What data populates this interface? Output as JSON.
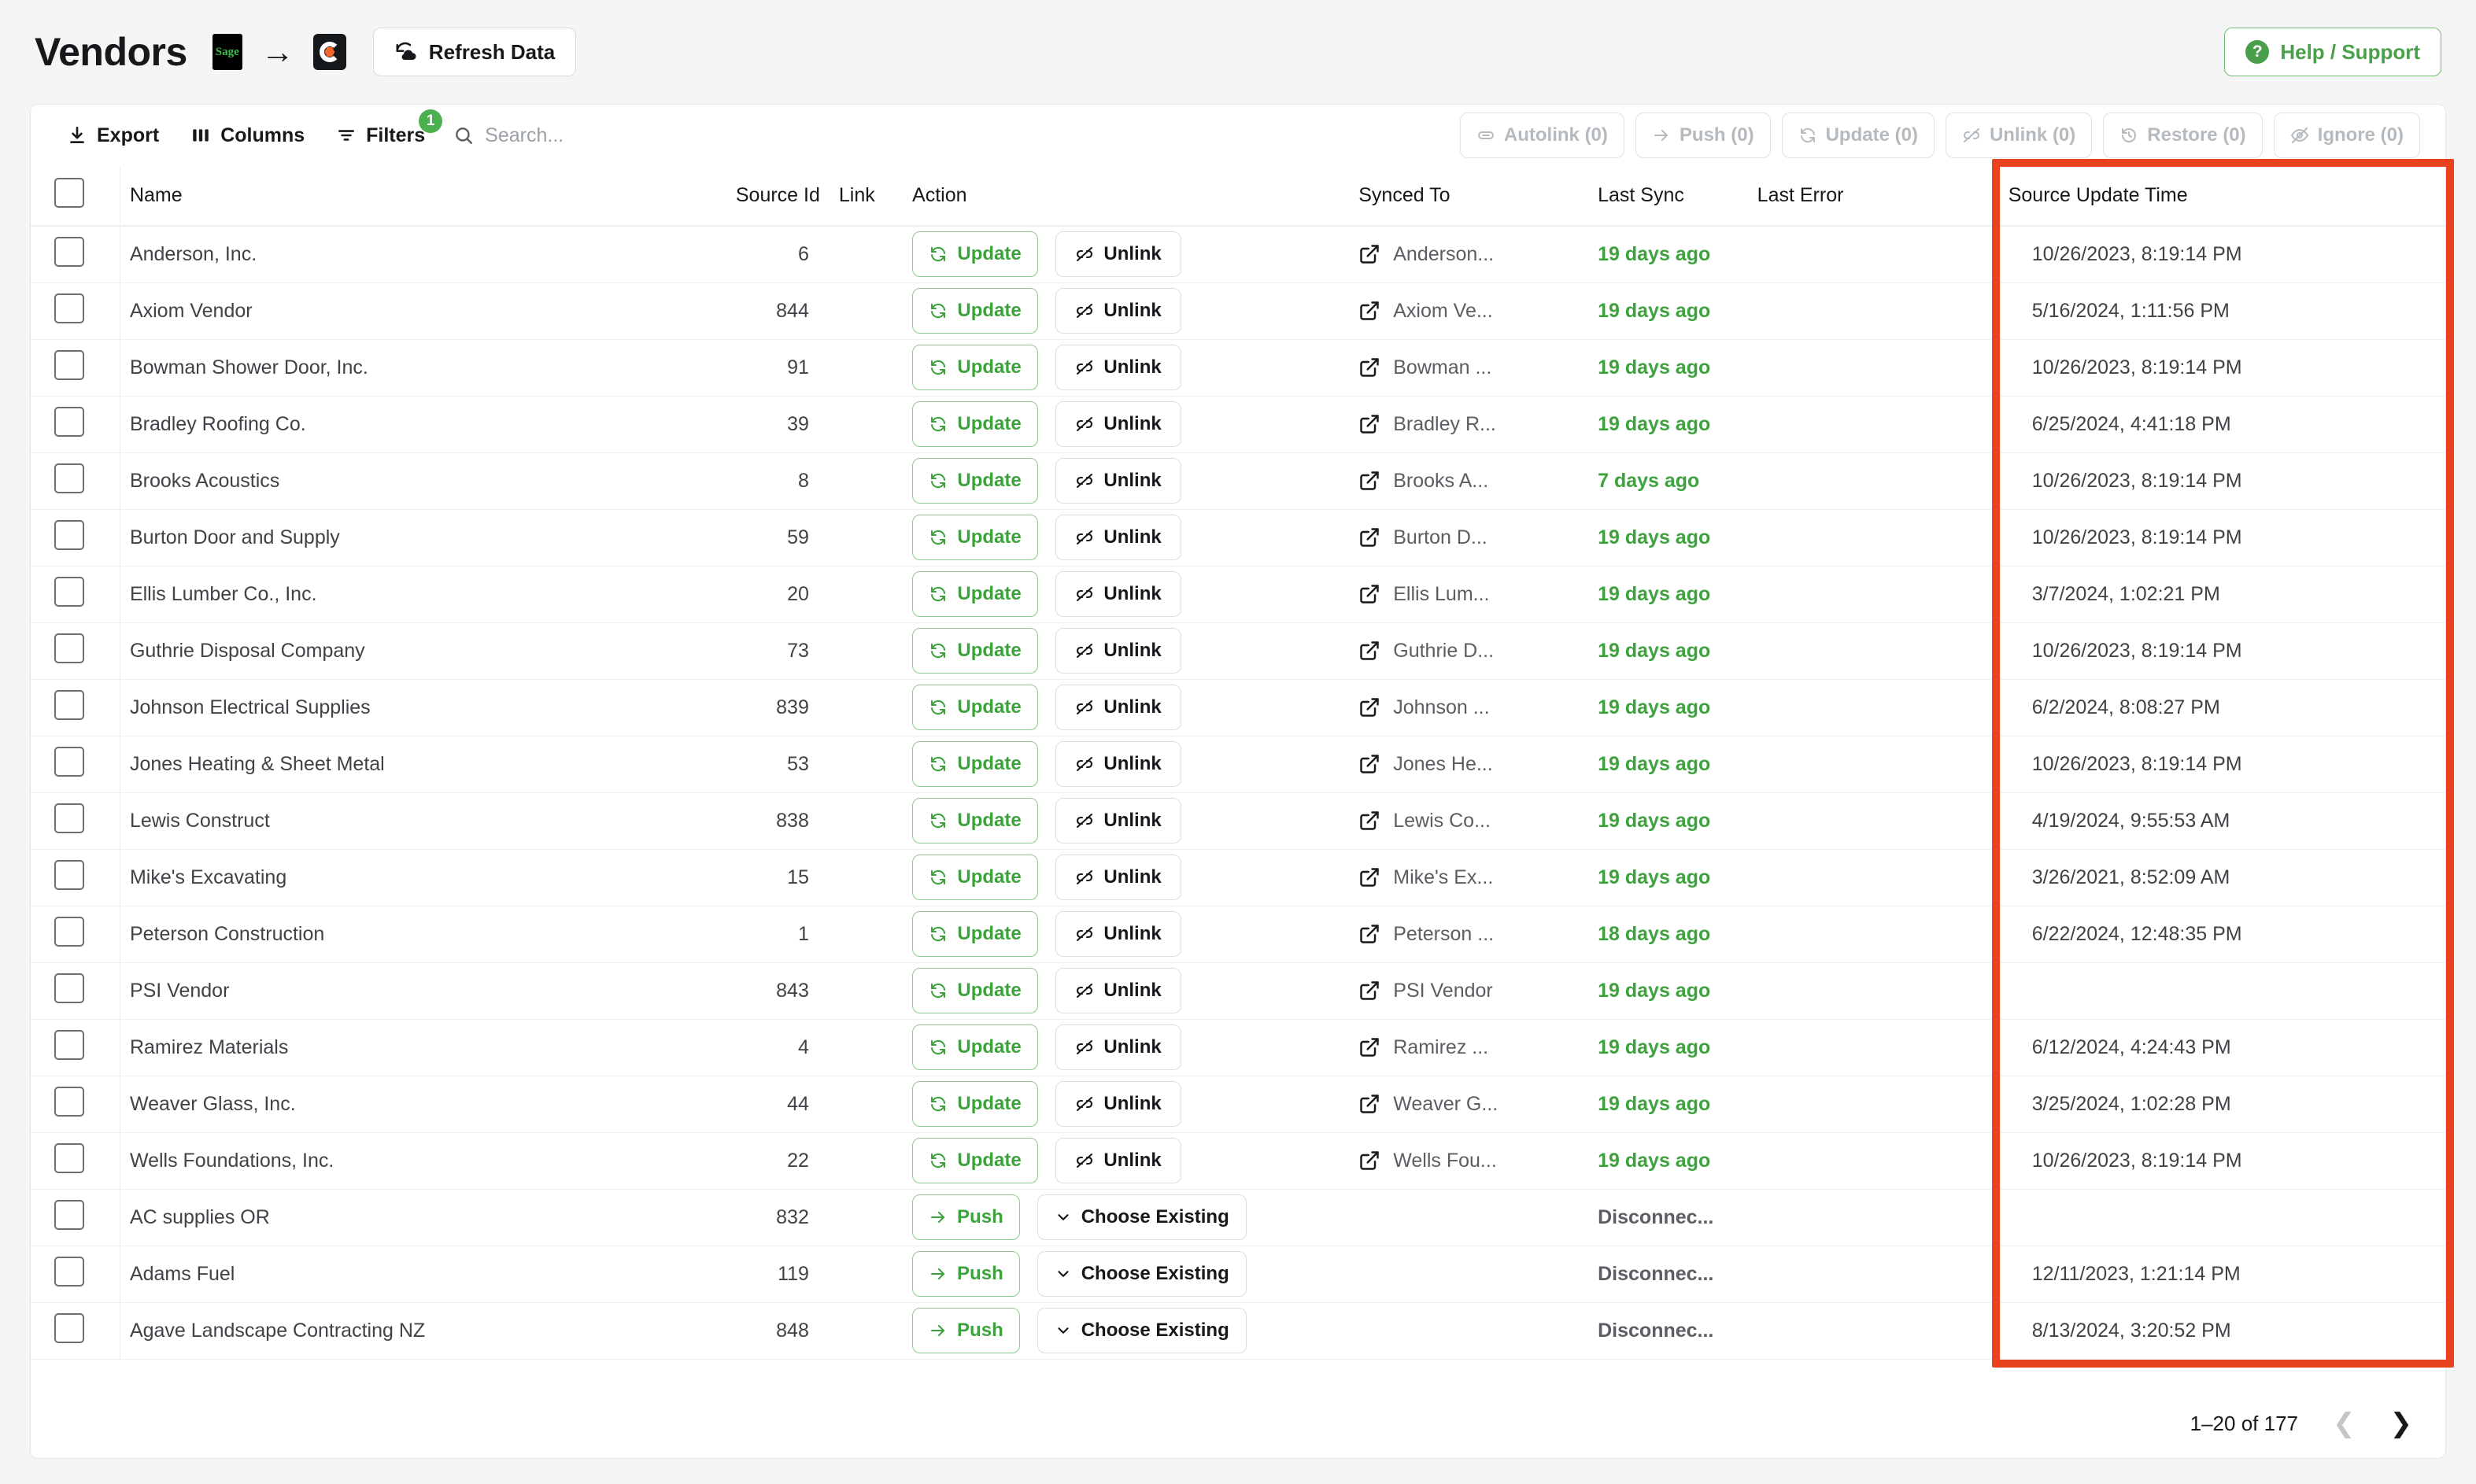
{
  "header": {
    "title": "Vendors",
    "source_logo_label": "Sage",
    "arrow": "→",
    "target_logo_label": "Procore",
    "refresh_label": "Refresh Data",
    "help_label": "Help / Support"
  },
  "toolbar": {
    "export_label": "Export",
    "columns_label": "Columns",
    "filters_label": "Filters",
    "filters_badge": "1",
    "search_placeholder": "Search...",
    "search_value": "",
    "bulk_actions": [
      {
        "label": "Autolink (0)",
        "icon": "link-icon",
        "disabled": true
      },
      {
        "label": "Push (0)",
        "icon": "arrow-right-icon",
        "disabled": true
      },
      {
        "label": "Update (0)",
        "icon": "refresh-icon",
        "disabled": true
      },
      {
        "label": "Unlink (0)",
        "icon": "unlink-icon",
        "disabled": true
      },
      {
        "label": "Restore (0)",
        "icon": "history-icon",
        "disabled": true
      },
      {
        "label": "Ignore (0)",
        "icon": "eye-off-icon",
        "disabled": true
      }
    ]
  },
  "table": {
    "columns": [
      "",
      "Name",
      "Source Id",
      "Link",
      "Action",
      "Synced To",
      "Last Sync",
      "Last Error",
      "Source Update Time"
    ],
    "rows": [
      {
        "name": "Anderson, Inc.",
        "source_id": "6",
        "action_primary": "Update",
        "action_secondary": "Unlink",
        "synced_to": "Anderson...",
        "last_sync": "19 days ago",
        "last_sync_state": "ok",
        "last_error": "",
        "source_update_time": "10/26/2023, 8:19:14 PM"
      },
      {
        "name": "Axiom Vendor",
        "source_id": "844",
        "action_primary": "Update",
        "action_secondary": "Unlink",
        "synced_to": "Axiom Ve...",
        "last_sync": "19 days ago",
        "last_sync_state": "ok",
        "last_error": "",
        "source_update_time": "5/16/2024, 1:11:56 PM"
      },
      {
        "name": "Bowman Shower Door, Inc.",
        "source_id": "91",
        "action_primary": "Update",
        "action_secondary": "Unlink",
        "synced_to": "Bowman ...",
        "last_sync": "19 days ago",
        "last_sync_state": "ok",
        "last_error": "",
        "source_update_time": "10/26/2023, 8:19:14 PM"
      },
      {
        "name": "Bradley Roofing Co.",
        "source_id": "39",
        "action_primary": "Update",
        "action_secondary": "Unlink",
        "synced_to": "Bradley R...",
        "last_sync": "19 days ago",
        "last_sync_state": "ok",
        "last_error": "",
        "source_update_time": "6/25/2024, 4:41:18 PM"
      },
      {
        "name": "Brooks Acoustics",
        "source_id": "8",
        "action_primary": "Update",
        "action_secondary": "Unlink",
        "synced_to": "Brooks A...",
        "last_sync": "7 days ago",
        "last_sync_state": "ok",
        "last_error": "",
        "source_update_time": "10/26/2023, 8:19:14 PM"
      },
      {
        "name": "Burton Door and Supply",
        "source_id": "59",
        "action_primary": "Update",
        "action_secondary": "Unlink",
        "synced_to": "Burton D...",
        "last_sync": "19 days ago",
        "last_sync_state": "ok",
        "last_error": "",
        "source_update_time": "10/26/2023, 8:19:14 PM"
      },
      {
        "name": "Ellis Lumber Co., Inc.",
        "source_id": "20",
        "action_primary": "Update",
        "action_secondary": "Unlink",
        "synced_to": "Ellis Lum...",
        "last_sync": "19 days ago",
        "last_sync_state": "ok",
        "last_error": "",
        "source_update_time": "3/7/2024, 1:02:21 PM"
      },
      {
        "name": "Guthrie Disposal Company",
        "source_id": "73",
        "action_primary": "Update",
        "action_secondary": "Unlink",
        "synced_to": "Guthrie D...",
        "last_sync": "19 days ago",
        "last_sync_state": "ok",
        "last_error": "",
        "source_update_time": "10/26/2023, 8:19:14 PM"
      },
      {
        "name": "Johnson Electrical Supplies",
        "source_id": "839",
        "action_primary": "Update",
        "action_secondary": "Unlink",
        "synced_to": "Johnson ...",
        "last_sync": "19 days ago",
        "last_sync_state": "ok",
        "last_error": "",
        "source_update_time": "6/2/2024, 8:08:27 PM"
      },
      {
        "name": "Jones Heating & Sheet Metal",
        "source_id": "53",
        "action_primary": "Update",
        "action_secondary": "Unlink",
        "synced_to": "Jones He...",
        "last_sync": "19 days ago",
        "last_sync_state": "ok",
        "last_error": "",
        "source_update_time": "10/26/2023, 8:19:14 PM"
      },
      {
        "name": "Lewis Construct",
        "source_id": "838",
        "action_primary": "Update",
        "action_secondary": "Unlink",
        "synced_to": "Lewis Co...",
        "last_sync": "19 days ago",
        "last_sync_state": "ok",
        "last_error": "",
        "source_update_time": "4/19/2024, 9:55:53 AM"
      },
      {
        "name": "Mike's Excavating",
        "source_id": "15",
        "action_primary": "Update",
        "action_secondary": "Unlink",
        "synced_to": "Mike's Ex...",
        "last_sync": "19 days ago",
        "last_sync_state": "ok",
        "last_error": "",
        "source_update_time": "3/26/2021, 8:52:09 AM"
      },
      {
        "name": "Peterson Construction",
        "source_id": "1",
        "action_primary": "Update",
        "action_secondary": "Unlink",
        "synced_to": "Peterson ...",
        "last_sync": "18 days ago",
        "last_sync_state": "ok",
        "last_error": "",
        "source_update_time": "6/22/2024, 12:48:35 PM"
      },
      {
        "name": "PSI Vendor",
        "source_id": "843",
        "action_primary": "Update",
        "action_secondary": "Unlink",
        "synced_to": "PSI Vendor",
        "last_sync": "19 days ago",
        "last_sync_state": "ok",
        "last_error": "",
        "source_update_time": ""
      },
      {
        "name": "Ramirez Materials",
        "source_id": "4",
        "action_primary": "Update",
        "action_secondary": "Unlink",
        "synced_to": "Ramirez ...",
        "last_sync": "19 days ago",
        "last_sync_state": "ok",
        "last_error": "",
        "source_update_time": "6/12/2024, 4:24:43 PM"
      },
      {
        "name": "Weaver Glass, Inc.",
        "source_id": "44",
        "action_primary": "Update",
        "action_secondary": "Unlink",
        "synced_to": "Weaver G...",
        "last_sync": "19 days ago",
        "last_sync_state": "ok",
        "last_error": "",
        "source_update_time": "3/25/2024, 1:02:28 PM"
      },
      {
        "name": "Wells Foundations, Inc.",
        "source_id": "22",
        "action_primary": "Update",
        "action_secondary": "Unlink",
        "synced_to": "Wells Fou...",
        "last_sync": "19 days ago",
        "last_sync_state": "ok",
        "last_error": "",
        "source_update_time": "10/26/2023, 8:19:14 PM"
      },
      {
        "name": "AC supplies OR",
        "source_id": "832",
        "action_primary": "Push",
        "action_secondary": "Choose Existing",
        "synced_to": "",
        "last_sync": "Disconnec...",
        "last_sync_state": "off",
        "last_error": "",
        "source_update_time": ""
      },
      {
        "name": "Adams Fuel",
        "source_id": "119",
        "action_primary": "Push",
        "action_secondary": "Choose Existing",
        "synced_to": "",
        "last_sync": "Disconnec...",
        "last_sync_state": "off",
        "last_error": "",
        "source_update_time": "12/11/2023, 1:21:14 PM"
      },
      {
        "name": "Agave Landscape Contracting NZ",
        "source_id": "848",
        "action_primary": "Push",
        "action_secondary": "Choose Existing",
        "synced_to": "",
        "last_sync": "Disconnec...",
        "last_sync_state": "off",
        "last_error": "",
        "source_update_time": "8/13/2024, 3:20:52 PM"
      }
    ]
  },
  "pagination": {
    "range_label": "1–20 of 177",
    "prev_icon": "chevron-left-icon",
    "next_icon": "chevron-right-icon",
    "prev_disabled": true
  },
  "annotation": {
    "color": "#e8431e",
    "target_column": "Source Update Time"
  }
}
